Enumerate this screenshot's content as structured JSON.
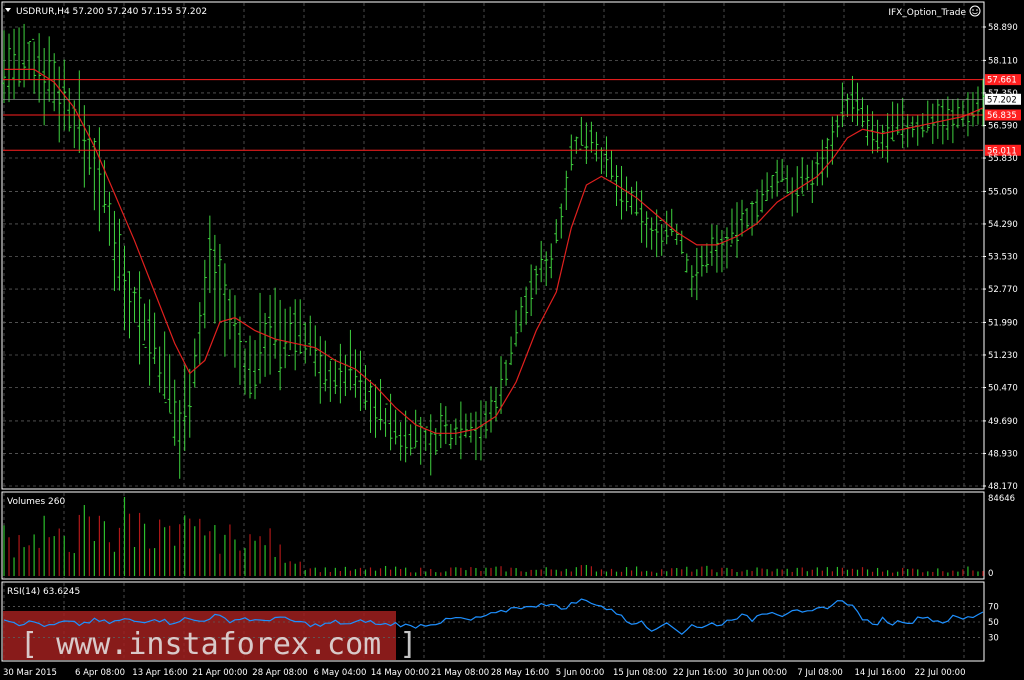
{
  "header": {
    "symbol_info": "USDRUR,H4  57.200 57.240 57.155 57.202",
    "expert_name": "IFX_Option_Trade",
    "expert_icon": "smiley-face-icon",
    "dropdown_icon": "triangle-down-icon"
  },
  "colors": {
    "background": "#000000",
    "grid": "#5c5c5c",
    "bars": "#3fd23f",
    "ma": "#e0201e",
    "level_line": "#ff2020",
    "rsi": "#1e90ff",
    "volume_up": "#2bbf2b",
    "volume_down": "#b01818",
    "watermark_band": "#a0201e"
  },
  "volumes_panel": {
    "title": "Volumes 260",
    "max_label": "84646",
    "min_label": "0"
  },
  "rsi_panel": {
    "title": "RSI(14) 63.6245",
    "levels": [
      "70",
      "50",
      "30"
    ]
  },
  "watermark": {
    "text": "[ www.instaforex.com ]"
  },
  "chart_data": {
    "type": "candlestick",
    "symbol": "USDRUR",
    "timeframe": "H4",
    "ylim": [
      48.17,
      58.89
    ],
    "y_ticks": [
      "58.890",
      "58.110",
      "57.350",
      "56.590",
      "55.830",
      "55.050",
      "54.290",
      "53.530",
      "52.770",
      "51.990",
      "51.230",
      "50.470",
      "49.690",
      "48.930",
      "48.170"
    ],
    "x_ticks": [
      "30 Mar 2015",
      "6 Apr 08:00",
      "13 Apr 16:00",
      "21 Apr 00:00",
      "28 Apr 08:00",
      "6 May 04:00",
      "14 May 00:00",
      "21 May 08:00",
      "28 May 16:00",
      "5 Jun 00:00",
      "15 Jun 08:00",
      "22 Jun 16:00",
      "30 Jun 00:00",
      "7 Jul 08:00",
      "14 Jul 16:00",
      "22 Jul 00:00"
    ],
    "price_series": [
      [
        0,
        58.0
      ],
      [
        3,
        57.9
      ],
      [
        6,
        58.1
      ],
      [
        9,
        57.8
      ],
      [
        12,
        57.2
      ],
      [
        15,
        56.6
      ],
      [
        18,
        55.7
      ],
      [
        21,
        54.5
      ],
      [
        24,
        53.0
      ],
      [
        27,
        52.2
      ],
      [
        30,
        51.4
      ],
      [
        33,
        50.3
      ],
      [
        35,
        49.4
      ],
      [
        37,
        50.5
      ],
      [
        39,
        51.7
      ],
      [
        41,
        53.5
      ],
      [
        43,
        53.0
      ],
      [
        45,
        52.0
      ],
      [
        47,
        51.3
      ],
      [
        49,
        50.7
      ],
      [
        51,
        51.4
      ],
      [
        53,
        52.0
      ],
      [
        55,
        51.3
      ],
      [
        57,
        51.7
      ],
      [
        59,
        51.8
      ],
      [
        61,
        51.6
      ],
      [
        63,
        50.9
      ],
      [
        65,
        50.8
      ],
      [
        67,
        50.7
      ],
      [
        69,
        51.0
      ],
      [
        71,
        50.6
      ],
      [
        73,
        50.2
      ],
      [
        75,
        49.9
      ],
      [
        77,
        49.6
      ],
      [
        79,
        49.3
      ],
      [
        81,
        49.4
      ],
      [
        83,
        49.3
      ],
      [
        85,
        49.1
      ],
      [
        87,
        49.5
      ],
      [
        89,
        49.4
      ],
      [
        91,
        49.6
      ],
      [
        93,
        49.6
      ],
      [
        95,
        49.4
      ],
      [
        97,
        49.9
      ],
      [
        99,
        50.5
      ],
      [
        101,
        51.3
      ],
      [
        103,
        52.2
      ],
      [
        105,
        52.7
      ],
      [
        107,
        53.3
      ],
      [
        109,
        53.5
      ],
      [
        111,
        54.6
      ],
      [
        113,
        55.9
      ],
      [
        115,
        56.3
      ],
      [
        117,
        56.4
      ],
      [
        119,
        55.9
      ],
      [
        121,
        55.5
      ],
      [
        123,
        55.0
      ],
      [
        125,
        54.8
      ],
      [
        127,
        54.5
      ],
      [
        129,
        54.0
      ],
      [
        131,
        54.1
      ],
      [
        133,
        54.3
      ],
      [
        135,
        53.8
      ],
      [
        137,
        53.0
      ],
      [
        139,
        53.3
      ],
      [
        141,
        53.8
      ],
      [
        143,
        53.7
      ],
      [
        145,
        54.0
      ],
      [
        147,
        54.3
      ],
      [
        149,
        54.6
      ],
      [
        151,
        54.8
      ],
      [
        153,
        55.2
      ],
      [
        155,
        55.5
      ],
      [
        157,
        55.1
      ],
      [
        159,
        55.2
      ],
      [
        161,
        55.4
      ],
      [
        163,
        55.7
      ],
      [
        165,
        56.3
      ],
      [
        167,
        57.0
      ],
      [
        169,
        57.2
      ],
      [
        171,
        56.8
      ],
      [
        173,
        56.3
      ],
      [
        175,
        56.2
      ],
      [
        177,
        56.5
      ],
      [
        179,
        56.6
      ],
      [
        181,
        56.5
      ],
      [
        183,
        56.6
      ],
      [
        185,
        56.8
      ],
      [
        187,
        56.8
      ],
      [
        189,
        56.7
      ],
      [
        191,
        56.9
      ],
      [
        193,
        57.0
      ],
      [
        195,
        57.2
      ]
    ],
    "ma_series": [
      [
        0,
        57.9
      ],
      [
        6,
        57.9
      ],
      [
        10,
        57.6
      ],
      [
        14,
        57.0
      ],
      [
        18,
        56.1
      ],
      [
        22,
        55.0
      ],
      [
        26,
        53.9
      ],
      [
        30,
        52.7
      ],
      [
        34,
        51.5
      ],
      [
        37,
        50.8
      ],
      [
        40,
        51.1
      ],
      [
        43,
        52.0
      ],
      [
        46,
        52.1
      ],
      [
        50,
        51.8
      ],
      [
        54,
        51.6
      ],
      [
        58,
        51.5
      ],
      [
        62,
        51.4
      ],
      [
        66,
        51.1
      ],
      [
        70,
        50.9
      ],
      [
        74,
        50.5
      ],
      [
        78,
        50.0
      ],
      [
        82,
        49.6
      ],
      [
        86,
        49.4
      ],
      [
        90,
        49.4
      ],
      [
        94,
        49.5
      ],
      [
        98,
        49.8
      ],
      [
        102,
        50.6
      ],
      [
        106,
        51.8
      ],
      [
        110,
        52.7
      ],
      [
        113,
        54.2
      ],
      [
        116,
        55.2
      ],
      [
        119,
        55.4
      ],
      [
        122,
        55.2
      ],
      [
        126,
        54.9
      ],
      [
        130,
        54.5
      ],
      [
        134,
        54.1
      ],
      [
        138,
        53.8
      ],
      [
        142,
        53.8
      ],
      [
        146,
        54.0
      ],
      [
        150,
        54.3
      ],
      [
        154,
        54.8
      ],
      [
        158,
        55.1
      ],
      [
        162,
        55.4
      ],
      [
        165,
        55.8
      ],
      [
        168,
        56.3
      ],
      [
        171,
        56.5
      ],
      [
        175,
        56.4
      ],
      [
        179,
        56.5
      ],
      [
        183,
        56.6
      ],
      [
        187,
        56.7
      ],
      [
        191,
        56.8
      ],
      [
        195,
        57.0
      ]
    ],
    "level_lines": [
      {
        "value": 57.661,
        "label": "57.661"
      },
      {
        "value": 56.835,
        "label": "56.835"
      },
      {
        "value": 56.011,
        "label": "56.011"
      }
    ],
    "current_price": {
      "value": 57.202,
      "label": "57.202"
    },
    "volumes": [
      [
        0,
        0.55
      ],
      [
        2,
        0.45
      ],
      [
        4,
        0.6
      ],
      [
        6,
        0.5
      ],
      [
        8,
        0.7
      ],
      [
        10,
        0.4
      ],
      [
        12,
        0.6
      ],
      [
        14,
        0.5
      ],
      [
        16,
        0.75
      ],
      [
        18,
        0.55
      ],
      [
        20,
        0.8
      ],
      [
        22,
        0.45
      ],
      [
        24,
        1.0
      ],
      [
        26,
        0.6
      ],
      [
        28,
        0.85
      ],
      [
        30,
        0.5
      ],
      [
        32,
        0.7
      ],
      [
        34,
        0.4
      ],
      [
        36,
        0.65
      ],
      [
        38,
        0.55
      ],
      [
        40,
        0.75
      ],
      [
        42,
        0.5
      ],
      [
        44,
        0.6
      ],
      [
        46,
        0.45
      ],
      [
        48,
        0.7
      ],
      [
        50,
        0.4
      ],
      [
        52,
        0.6
      ],
      [
        54,
        0.35
      ],
      [
        56,
        0.3
      ],
      [
        58,
        0.25
      ],
      [
        60,
        0.15
      ],
      [
        62,
        0.1
      ],
      [
        64,
        0.09
      ],
      [
        66,
        0.1
      ],
      [
        70,
        0.08
      ],
      [
        75,
        0.1
      ],
      [
        80,
        0.09
      ],
      [
        85,
        0.08
      ],
      [
        90,
        0.1
      ],
      [
        95,
        0.09
      ],
      [
        100,
        0.1
      ],
      [
        105,
        0.08
      ],
      [
        110,
        0.1
      ],
      [
        115,
        0.12
      ],
      [
        120,
        0.09
      ],
      [
        125,
        0.1
      ],
      [
        130,
        0.08
      ],
      [
        135,
        0.09
      ],
      [
        140,
        0.1
      ],
      [
        145,
        0.08
      ],
      [
        150,
        0.09
      ],
      [
        155,
        0.08
      ],
      [
        160,
        0.1
      ],
      [
        165,
        0.09
      ],
      [
        170,
        0.1
      ],
      [
        175,
        0.08
      ],
      [
        180,
        0.09
      ],
      [
        185,
        0.08
      ],
      [
        190,
        0.09
      ],
      [
        195,
        0.1
      ]
    ],
    "rsi_series": [
      [
        0,
        55
      ],
      [
        3,
        48
      ],
      [
        6,
        50
      ],
      [
        9,
        44
      ],
      [
        12,
        50
      ],
      [
        15,
        47
      ],
      [
        18,
        52
      ],
      [
        21,
        49
      ],
      [
        24,
        53
      ],
      [
        27,
        50
      ],
      [
        30,
        55
      ],
      [
        33,
        49
      ],
      [
        36,
        54
      ],
      [
        39,
        51
      ],
      [
        42,
        58
      ],
      [
        45,
        52
      ],
      [
        48,
        55
      ],
      [
        51,
        50
      ],
      [
        54,
        56
      ],
      [
        57,
        52
      ],
      [
        60,
        48
      ],
      [
        63,
        45
      ],
      [
        66,
        50
      ],
      [
        69,
        47
      ],
      [
        72,
        52
      ],
      [
        75,
        46
      ],
      [
        78,
        48
      ],
      [
        81,
        44
      ],
      [
        84,
        47
      ],
      [
        87,
        50
      ],
      [
        90,
        55
      ],
      [
        93,
        52
      ],
      [
        96,
        58
      ],
      [
        99,
        62
      ],
      [
        102,
        70
      ],
      [
        105,
        68
      ],
      [
        107,
        75
      ],
      [
        109,
        72
      ],
      [
        111,
        67
      ],
      [
        113,
        73
      ],
      [
        115,
        78
      ],
      [
        117,
        76
      ],
      [
        119,
        70
      ],
      [
        121,
        64
      ],
      [
        123,
        60
      ],
      [
        125,
        45
      ],
      [
        127,
        52
      ],
      [
        129,
        40
      ],
      [
        131,
        48
      ],
      [
        133,
        44
      ],
      [
        135,
        36
      ],
      [
        137,
        47
      ],
      [
        139,
        42
      ],
      [
        141,
        48
      ],
      [
        143,
        47
      ],
      [
        145,
        55
      ],
      [
        147,
        58
      ],
      [
        149,
        53
      ],
      [
        151,
        62
      ],
      [
        153,
        64
      ],
      [
        155,
        59
      ],
      [
        157,
        66
      ],
      [
        159,
        60
      ],
      [
        161,
        63
      ],
      [
        163,
        68
      ],
      [
        165,
        72
      ],
      [
        167,
        79
      ],
      [
        169,
        70
      ],
      [
        171,
        55
      ],
      [
        173,
        45
      ],
      [
        175,
        54
      ],
      [
        177,
        48
      ],
      [
        179,
        52
      ],
      [
        181,
        50
      ],
      [
        183,
        58
      ],
      [
        185,
        53
      ],
      [
        187,
        50
      ],
      [
        189,
        56
      ],
      [
        191,
        54
      ],
      [
        193,
        57
      ],
      [
        195,
        64
      ]
    ]
  }
}
